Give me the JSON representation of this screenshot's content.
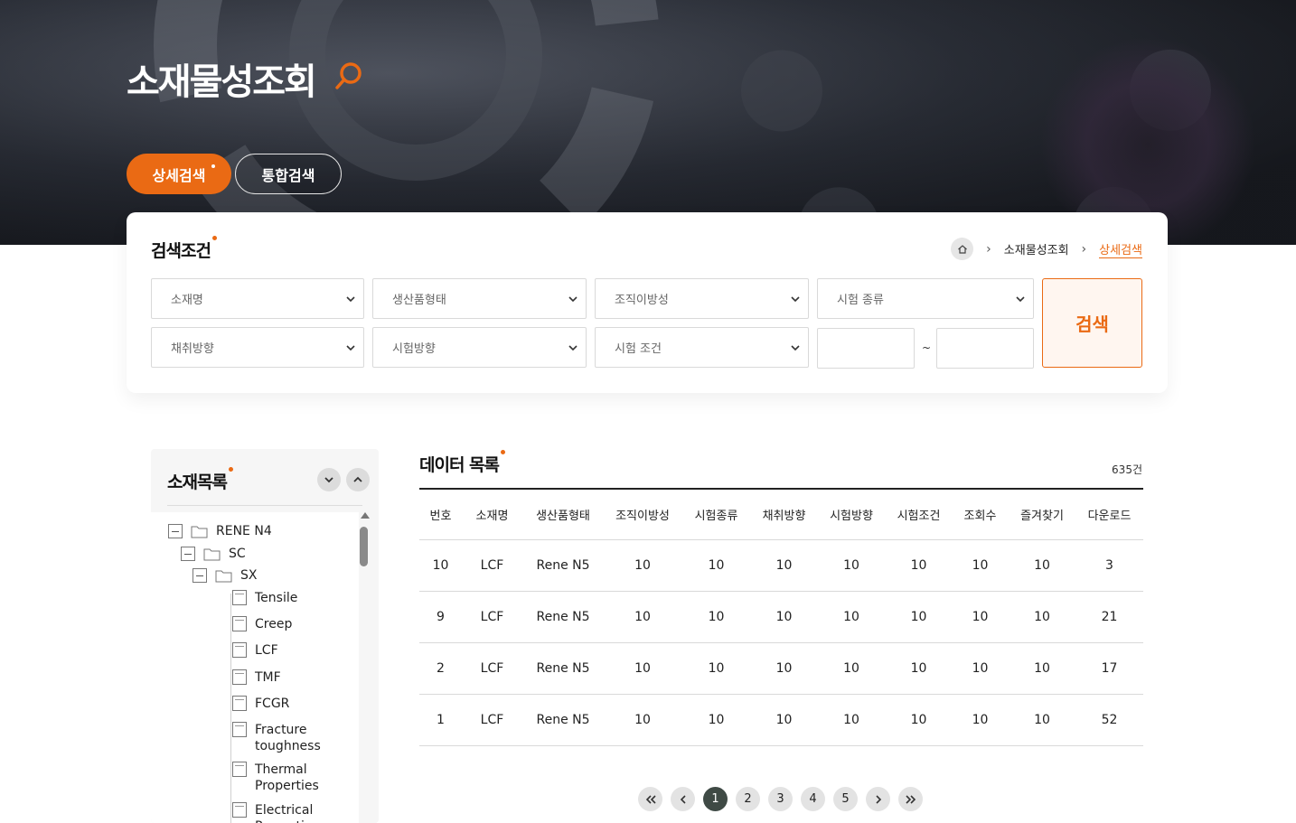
{
  "header": {
    "title": "소재물성조회",
    "tabs": [
      {
        "label": "상세검색",
        "active": true
      },
      {
        "label": "통합검색",
        "active": false
      }
    ]
  },
  "search": {
    "title": "검색조건",
    "breadcrumb": [
      "소재물성조회",
      "상세검색"
    ],
    "selects_row1": [
      "소재명",
      "생산품형태",
      "조직이방성",
      "시험 종류"
    ],
    "selects_row2": [
      "채취방향",
      "시험방향",
      "시험 조건"
    ],
    "range_from": "",
    "range_to": "",
    "tilde": "~",
    "button_label": "검색"
  },
  "tree": {
    "title": "소재목록",
    "nodes": [
      {
        "label": "RENE N4",
        "type": "folder"
      },
      {
        "label": "SC",
        "type": "folder"
      },
      {
        "label": "SX",
        "type": "folder"
      },
      {
        "label": "Tensile",
        "type": "doc"
      },
      {
        "label": "Creep",
        "type": "doc"
      },
      {
        "label": "LCF",
        "type": "doc"
      },
      {
        "label": "TMF",
        "type": "doc"
      },
      {
        "label": "FCGR",
        "type": "doc"
      },
      {
        "label": "Fracture toughness",
        "type": "doc"
      },
      {
        "label": "Thermal Properties",
        "type": "doc"
      },
      {
        "label": "Electrical Properties",
        "type": "doc"
      }
    ]
  },
  "list": {
    "title": "데이터 목록",
    "count": "635건",
    "columns": [
      "번호",
      "소재명",
      "생산품형태",
      "조직이방성",
      "시험종류",
      "채취방향",
      "시험방향",
      "시험조건",
      "조회수",
      "즐겨찾기",
      "다운로드"
    ],
    "rows": [
      [
        "10",
        "LCF",
        "Rene N5",
        "10",
        "10",
        "10",
        "10",
        "10",
        "10",
        "10",
        "3"
      ],
      [
        "9",
        "LCF",
        "Rene N5",
        "10",
        "10",
        "10",
        "10",
        "10",
        "10",
        "10",
        "21"
      ],
      [
        "2",
        "LCF",
        "Rene N5",
        "10",
        "10",
        "10",
        "10",
        "10",
        "10",
        "10",
        "17"
      ],
      [
        "1",
        "LCF",
        "Rene N5",
        "10",
        "10",
        "10",
        "10",
        "10",
        "10",
        "10",
        "52"
      ]
    ]
  },
  "pagination": {
    "pages": [
      "1",
      "2",
      "3",
      "4",
      "5"
    ],
    "current": "1"
  },
  "colors": {
    "accent": "#ea6a14",
    "pager_active": "#3f4a45"
  }
}
